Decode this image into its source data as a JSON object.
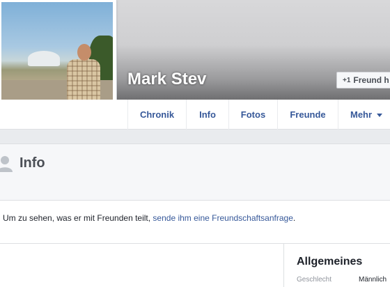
{
  "profile": {
    "name": "Mark Stev",
    "friend_button_label": "Freund h",
    "friend_button_icon": "+1"
  },
  "tabs": [
    {
      "label": "Chronik"
    },
    {
      "label": "Info"
    },
    {
      "label": "Fotos"
    },
    {
      "label": "Freunde"
    },
    {
      "label": "Mehr"
    }
  ],
  "info_section": {
    "title": "Info"
  },
  "notice": {
    "text": "Um zu sehen, was er mit Freunden teilt, ",
    "link": "sende ihm eine Freundschaftsanfrage",
    "suffix": "."
  },
  "general": {
    "title": "Allgemeines",
    "gender_label": "Geschlecht",
    "gender_value": "Männlich"
  },
  "colors": {
    "link": "#365899",
    "background": "#e9ebee"
  }
}
